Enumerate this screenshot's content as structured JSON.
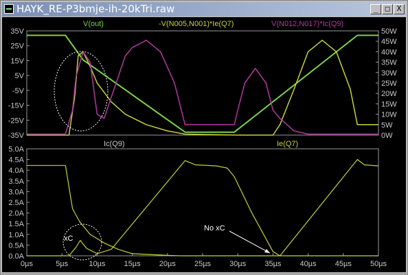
{
  "window": {
    "title": "HAYK_RE-P3bmje-ih-20kTri.raw",
    "minimize_label": "_",
    "maximize_label": "□",
    "close_label": "X"
  },
  "colors": {
    "background": "#000000",
    "vout": "#7bd34a",
    "power_q7": "#c8d23c",
    "power_q9": "#b13aa0",
    "current": "#c8d23c",
    "annotation": "#ffffff",
    "axis_text": "#c8c8c8"
  },
  "top_pane": {
    "legend": {
      "vout": "V(out)",
      "power_q7": "-V(N005,N001)*Ie(Q7)",
      "power_q9": "V(N012,N017)*Ic(Q9)"
    },
    "left_ticks": [
      "35V",
      "25V",
      "15V",
      "5V",
      "-5V",
      "-15V",
      "-25V",
      "-35V"
    ],
    "right_ticks": [
      "50W",
      "45W",
      "40W",
      "35W",
      "30W",
      "25W",
      "20W",
      "15W",
      "10W",
      "5W",
      "0W"
    ]
  },
  "bottom_pane": {
    "legend": {
      "q9": "Ic(Q9)",
      "q7": "Ie(Q7)"
    },
    "left_ticks": [
      "5.0A",
      "4.5A",
      "4.0A",
      "3.5A",
      "3.0A",
      "2.5A",
      "2.0A",
      "1.5A",
      "1.0A",
      "0.5A",
      "0.0A"
    ],
    "x_ticks": [
      "0µs",
      "5µs",
      "10µs",
      "15µs",
      "20µs",
      "25µs",
      "30µs",
      "35µs",
      "40µs",
      "45µs",
      "50µs"
    ],
    "annotations": {
      "xc": "xC",
      "no_xc": "No xC"
    }
  },
  "chart_data": [
    {
      "type": "line",
      "x_unit": "µs",
      "xlim": [
        0,
        50
      ],
      "ylim_left": [
        -35,
        35
      ],
      "ylim_right": [
        0,
        50
      ],
      "series": [
        {
          "name": "V(out)",
          "axis": "left",
          "x": [
            0,
            5.5,
            8,
            22.5,
            29.5,
            47,
            50
          ],
          "y": [
            32,
            32,
            15.5,
            -33,
            -33,
            32,
            32
          ]
        },
        {
          "name": "-V(N005,N001)*Ie(Q7)",
          "axis": "right",
          "x": [
            0,
            6,
            6.8,
            7.3,
            8,
            9,
            10,
            12,
            14,
            17,
            20,
            22.5,
            30,
            34,
            35,
            36,
            38,
            40,
            42,
            44,
            46,
            47,
            50
          ],
          "y": [
            0,
            0,
            18,
            38,
            40,
            33,
            25,
            16,
            10,
            5,
            2,
            0.5,
            0,
            0,
            0,
            5,
            22,
            40,
            45.5,
            40,
            22,
            5,
            5
          ]
        },
        {
          "name": "V(N012,N017)*Ic(Q9)",
          "axis": "right",
          "x": [
            0,
            5.5,
            6.5,
            7,
            8,
            9,
            10,
            11,
            12,
            14,
            15,
            17,
            19,
            21,
            22.5,
            29.5,
            30,
            31,
            32.5,
            34,
            35,
            36,
            37,
            38,
            40,
            50
          ],
          "y": [
            0.5,
            0.5,
            12,
            28,
            40,
            35,
            10,
            8,
            18,
            38,
            42,
            45.5,
            40,
            25,
            5,
            5,
            12,
            25,
            32,
            25,
            12,
            8,
            5,
            2,
            0.5,
            0.5
          ]
        }
      ]
    },
    {
      "type": "line",
      "x_unit": "µs",
      "xlim": [
        0,
        50
      ],
      "ylim": [
        0,
        5
      ],
      "series": [
        {
          "name": "Ic(Q9)",
          "x": [
            0,
            5.5,
            6.5,
            7.5,
            9,
            11,
            13,
            15,
            20,
            22,
            22.5,
            24,
            27,
            28.5,
            29.5,
            31,
            33,
            35,
            37,
            40,
            50
          ],
          "y": [
            4.22,
            4.22,
            2.2,
            1.6,
            1.0,
            0.6,
            0.3,
            0.1,
            0.02,
            0.0,
            0.0,
            0.0,
            0.0,
            0.0,
            0.0,
            0.0,
            0.0,
            0.0,
            0.0,
            0.0,
            0.0
          ]
        },
        {
          "name": "Ie(Q7)",
          "x": [
            0,
            6,
            7,
            7.6,
            8.5,
            10,
            12,
            22.5,
            24,
            27,
            28.5,
            29.5,
            32,
            35,
            36,
            47,
            48,
            50
          ],
          "y": [
            0,
            0,
            0.4,
            0.72,
            0.35,
            0.1,
            0.3,
            4.45,
            4.25,
            4.2,
            4.1,
            3.7,
            2.0,
            0.2,
            0.0,
            4.5,
            4.25,
            4.2
          ]
        }
      ]
    }
  ]
}
